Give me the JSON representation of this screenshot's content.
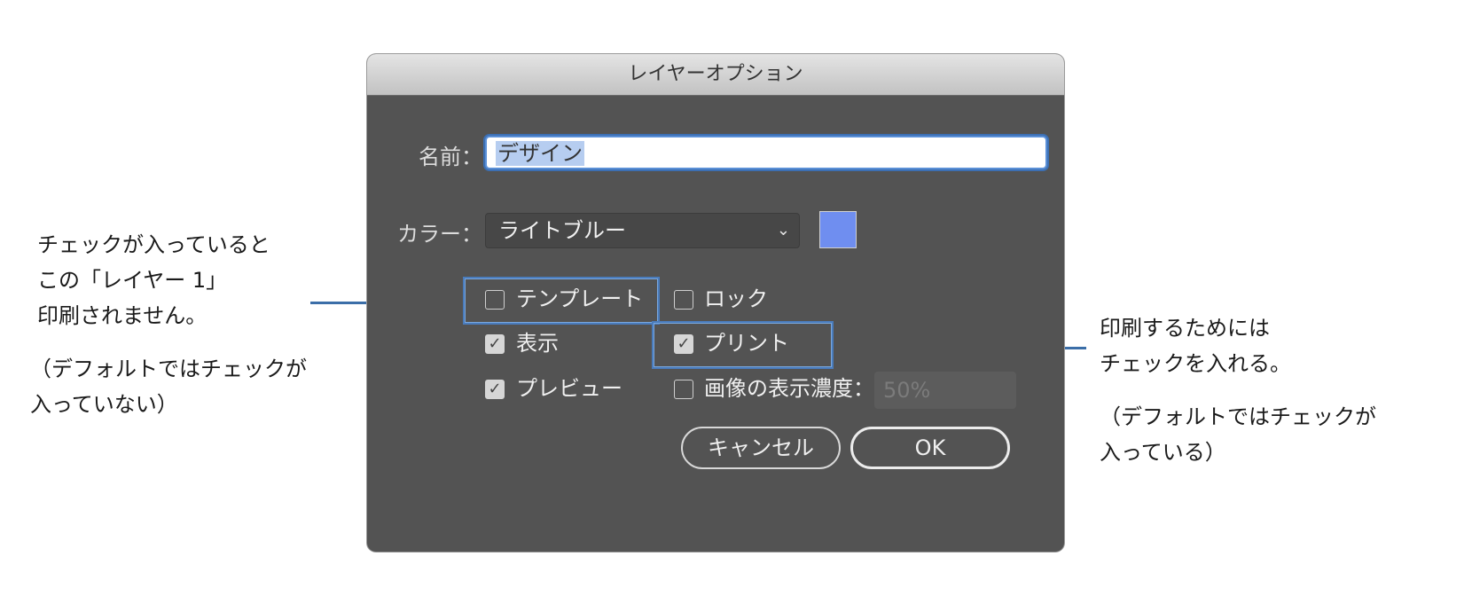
{
  "dialog": {
    "title": "レイヤーオプション",
    "name_label": "名前：",
    "name_value": "デザイン",
    "color_label": "カラー：",
    "color_value": "ライトブルー",
    "swatch_color": "#6f8ef0",
    "checkboxes": [
      {
        "label": "テンプレート",
        "checked": false
      },
      {
        "label": "ロック",
        "checked": false
      },
      {
        "label": "表示",
        "checked": true
      },
      {
        "label": "プリント",
        "checked": true
      },
      {
        "label": "プレビュー",
        "checked": true
      },
      {
        "label": "画像の表示濃度：",
        "checked": false
      }
    ],
    "opacity_value": "50%",
    "cancel_label": "キャンセル",
    "ok_label": "OK"
  },
  "annotations": {
    "left": {
      "lines": [
        "チェックが入っていると",
        "この「レイヤー 1」",
        "印刷されません。"
      ],
      "note_lines": [
        "（デフォルトではチェックが",
        "入っていない）"
      ]
    },
    "right": {
      "lines": [
        "印刷するためには",
        "チェックを入れる。"
      ],
      "note_lines": [
        "（デフォルトではチェックが",
        "入っている）"
      ]
    },
    "accent_color": "#3b6ea8"
  }
}
